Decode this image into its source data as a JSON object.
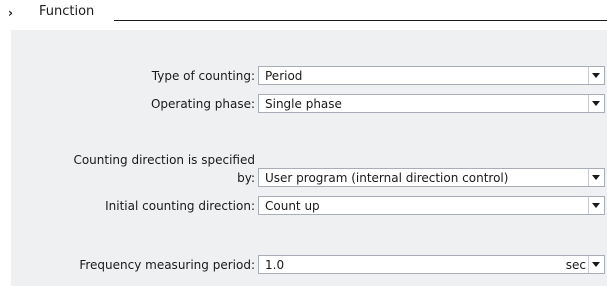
{
  "section": {
    "title": "Function",
    "chevron_icon": "chevron-right-icon"
  },
  "fields": {
    "type_of_counting": {
      "label": "Type of counting:",
      "value": "Period"
    },
    "operating_phase": {
      "label": "Operating phase:",
      "value": "Single phase"
    },
    "counting_direction_spec": {
      "label_line1": "Counting direction is specified",
      "label_line2": "by:",
      "value": "User program (internal direction control)"
    },
    "initial_counting_direction": {
      "label": "Initial counting direction:",
      "value": "Count up"
    },
    "frequency_measuring_period": {
      "label": "Frequency measuring period:",
      "value": "1.0",
      "unit": "sec"
    }
  }
}
